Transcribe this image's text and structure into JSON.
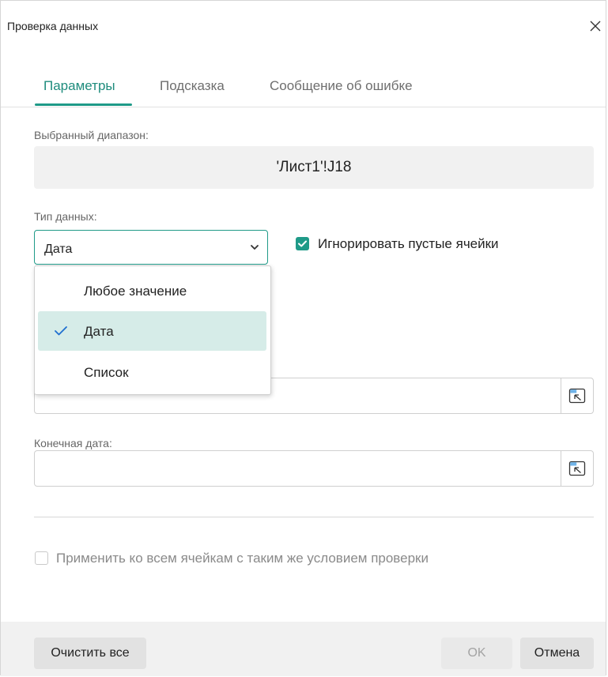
{
  "dialog": {
    "title": "Проверка данных",
    "close_icon": "close-icon"
  },
  "tabs": [
    {
      "label": "Параметры",
      "active": true
    },
    {
      "label": "Подсказка",
      "active": false
    },
    {
      "label": "Сообщение об ошибке",
      "active": false
    }
  ],
  "range": {
    "label": "Выбранный диапазон:",
    "value": "'Лист1'!J18"
  },
  "data_type": {
    "label": "Тип данных:",
    "selected": "Дата",
    "options": [
      {
        "label": "Любое значение",
        "selected": false
      },
      {
        "label": "Дата",
        "selected": true
      },
      {
        "label": "Список",
        "selected": false
      }
    ]
  },
  "ignore_empty": {
    "label": "Игнорировать пустые ячейки",
    "checked": true
  },
  "end_date": {
    "label": "Конечная дата:",
    "value": ""
  },
  "apply_all": {
    "label": "Применить ко всем ячейкам с таким же условием проверки",
    "checked": false,
    "disabled": true
  },
  "footer": {
    "clear_label": "Очистить все",
    "ok_label": "OK",
    "cancel_label": "Отмена"
  },
  "colors": {
    "accent": "#1f9a88",
    "selected_row": "#d6ece8"
  }
}
